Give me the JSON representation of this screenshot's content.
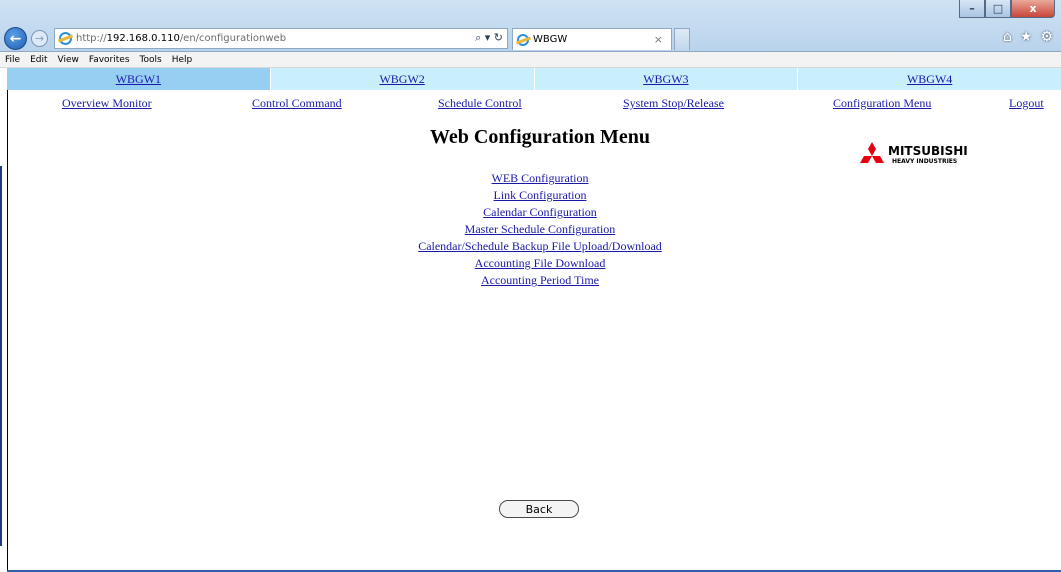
{
  "browser": {
    "url_prefix": "http://",
    "url_host": "192.168.0.110",
    "url_path": "/en/configurationweb",
    "search_glyph": "⌕ ▾ ↻",
    "tab_title": "WBGW",
    "tab_close": "×",
    "window_controls": {
      "minimize": "–",
      "maximize": "□",
      "close": "x"
    },
    "back_glyph": "←",
    "forward_glyph": "→",
    "right_icons": {
      "home": "⌂",
      "favorites": "★",
      "tools": "⚙"
    },
    "menu": [
      "File",
      "Edit",
      "View",
      "Favorites",
      "Tools",
      "Help"
    ]
  },
  "gateways": [
    {
      "label": "WBGW1",
      "active": true
    },
    {
      "label": "WBGW2",
      "active": false
    },
    {
      "label": "WBGW3",
      "active": false
    },
    {
      "label": "WBGW4",
      "active": false
    }
  ],
  "nav": [
    "Overview Monitor",
    "Control Command",
    "Schedule Control",
    "System Stop/Release",
    "Configuration Menu",
    "Logout"
  ],
  "page_title": "Web Configuration Menu",
  "logo": {
    "name": "MITSUBISHI",
    "sub": "HEAVY INDUSTRIES",
    "color": "#e60012"
  },
  "config_links": [
    "WEB Configuration",
    "Link Configuration",
    "Calendar Configuration",
    "Master Schedule Configuration",
    "Calendar/Schedule Backup File Upload/Download",
    "Accounting File Download",
    "Accounting Period Time"
  ],
  "back_button": "Back",
  "colors": {
    "link": "#1a1aa8",
    "gw_tab": "#c9eefc",
    "gw_tab_active": "#96cff2"
  }
}
